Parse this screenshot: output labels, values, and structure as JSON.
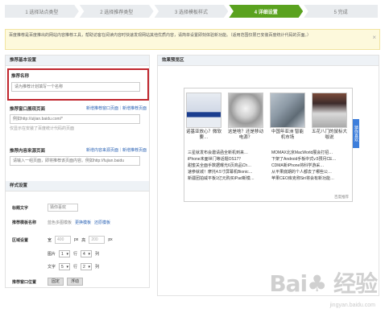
{
  "steps": [
    {
      "label": "1  选择站点类型"
    },
    {
      "label": "2  选择推荐类型"
    },
    {
      "label": "3  选择模板样式"
    },
    {
      "label": "4  详细设置"
    },
    {
      "label": "5  完成"
    }
  ],
  "notice": {
    "text": "百度推荐是百度推出的网站内容推荐工具，帮助访客在阅读内容时快速发现网站其他优质内容，请简单设置即刻体验新功能。（适用范围仅限已安装百度统计代码的页面。）",
    "close_icon": "×"
  },
  "left": {
    "title": "推荐基本设置",
    "name": {
      "label": "推荐名称",
      "placeholder": "请为推荐计划填写一个名称"
    },
    "page_section": {
      "label": "推荐窗口展现页面",
      "links": "新增推荐窗口页面｜新增推荐页面",
      "placeholder": "例如http://uijian.baidu.com/*",
      "hint": "仅显示在安装了百度统计代码的页面"
    },
    "content_section": {
      "label": "推荐内容来源页面",
      "links": "新增内容来源页面｜新增推荐页面",
      "placeholder": "请输入一组页面，即将推荐该页面内容。例如http://fujian.baidu"
    },
    "style": {
      "title": "样式设置",
      "title_text": {
        "label": "标题文字",
        "placeholder": "猜你喜欢"
      },
      "template_color": {
        "label": "推荐模板名称",
        "value": "蓝色多图模板",
        "link1": "更换模板",
        "link2": "还原模板"
      },
      "area": {
        "label": "区域设置",
        "w_label": "宽",
        "w_value": "400",
        "unit": "px",
        "h_label": "高",
        "h_value": "200"
      },
      "image_row": {
        "label": "图片",
        "rows": "1",
        "rows_unit": "行",
        "cols": "4",
        "cols_unit": "列"
      },
      "text_row": {
        "label": "文字",
        "rows": "5",
        "rows_unit": "行",
        "cols": "2",
        "cols_unit": "列"
      },
      "position": {
        "label": "推荐窗口位置",
        "opt1": "固定",
        "opt2": "浮动"
      }
    }
  },
  "right": {
    "title": "效果预览区",
    "side_tab": "猜你喜欢",
    "thumbs": [
      {
        "caption": "诺基亚放心？微软要…"
      },
      {
        "caption": "这是啥？还是移动电源？"
      },
      {
        "caption": "中国年亚洲 智能机市场"
      },
      {
        "caption": "五花八门的鼠标大咖说"
      }
    ],
    "news_col1": [
      "三星就发布会邀请函全新机到来…",
      "iPhone未面世门等话题OS17？",
      "甜蜜关全面手数据曝光6页商品Ch…",
      "速参就城！摩托4.5寸屏幕机Bionic…",
      "新疆团拍威平板1亿元购买iPad新模…"
    ],
    "news_col2": [
      "MOMAX北京MacWorld展会打招…",
      "下架了Android手板中式v.5预月CE…",
      "CDMA新iPhone将科学游采…",
      "从平果底期的个人都去了哪些公…",
      "苹果CEO库克称Siri将会有新功能…"
    ],
    "footer": "百度推荐"
  },
  "watermark": {
    "main": "Bai♣ 经验",
    "sub": "jingyan.baidu.com"
  }
}
